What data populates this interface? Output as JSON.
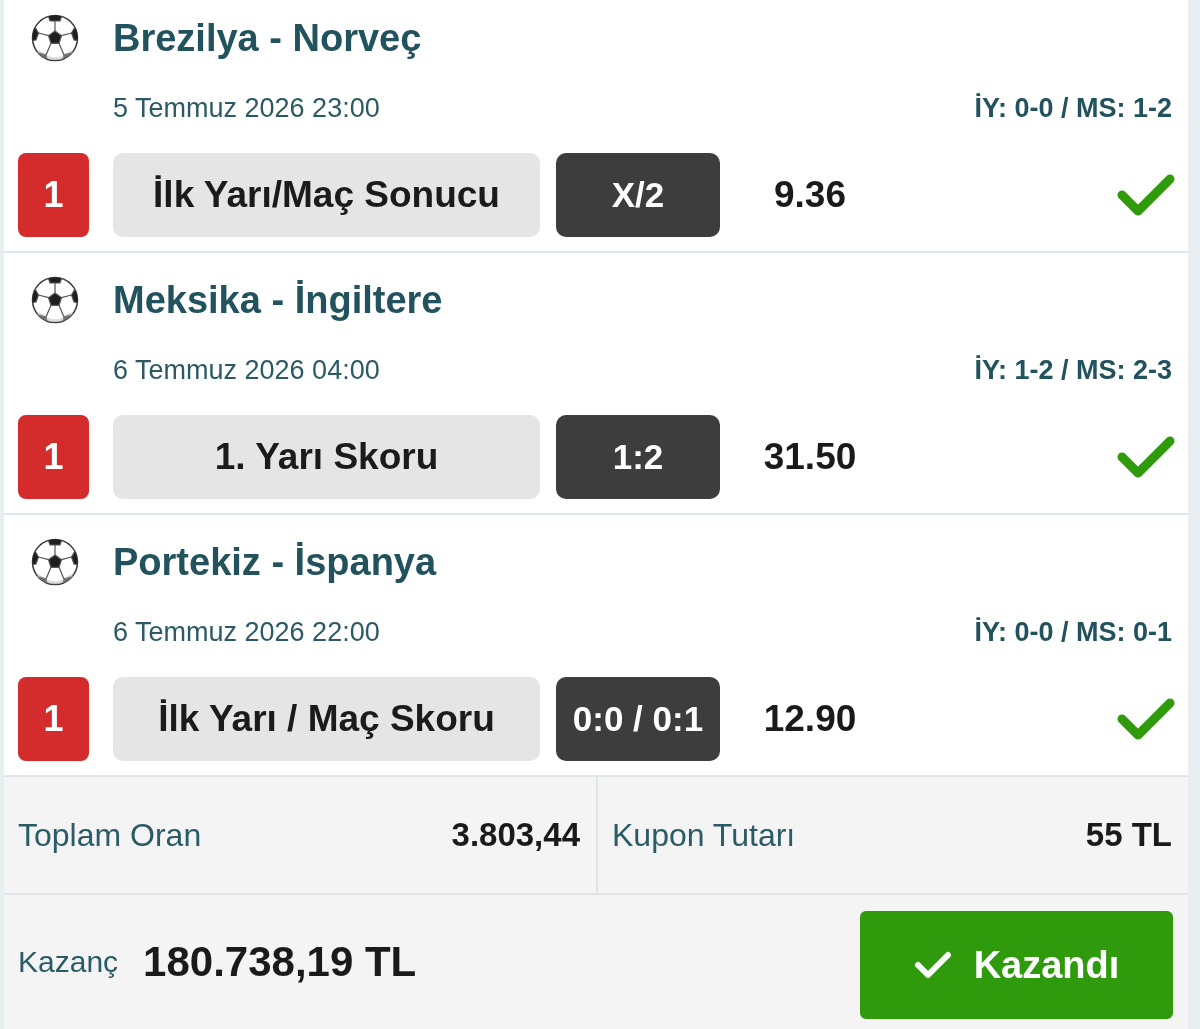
{
  "matches": [
    {
      "title": "Brezilya - Norveç",
      "date": "5 Temmuz 2026 23:00",
      "result": "İY: 0-0 / MS: 1-2",
      "badge": "1",
      "market": "İlk Yarı/Maç Sonucu",
      "selection": "X/2",
      "odds": "9.36",
      "won": true
    },
    {
      "title": "Meksika - İngiltere",
      "date": "6 Temmuz 2026 04:00",
      "result": "İY: 1-2 / MS: 2-3",
      "badge": "1",
      "market": "1. Yarı Skoru",
      "selection": "1:2",
      "odds": "31.50",
      "won": true
    },
    {
      "title": "Portekiz - İspanya",
      "date": "6 Temmuz 2026 22:00",
      "result": "İY: 0-0 / MS: 0-1",
      "badge": "1",
      "market": "İlk Yarı / Maç Skoru",
      "selection": "0:0 / 0:1",
      "odds": "12.90",
      "won": true
    }
  ],
  "summary": {
    "total_odds_label": "Toplam Oran",
    "total_odds": "3.803,44",
    "stake_label": "Kupon Tutarı",
    "stake": "55 TL",
    "winnings_label": "Kazanç",
    "winnings": "180.738,19 TL",
    "result_button": {
      "label": "Kazandı",
      "won": true
    }
  }
}
